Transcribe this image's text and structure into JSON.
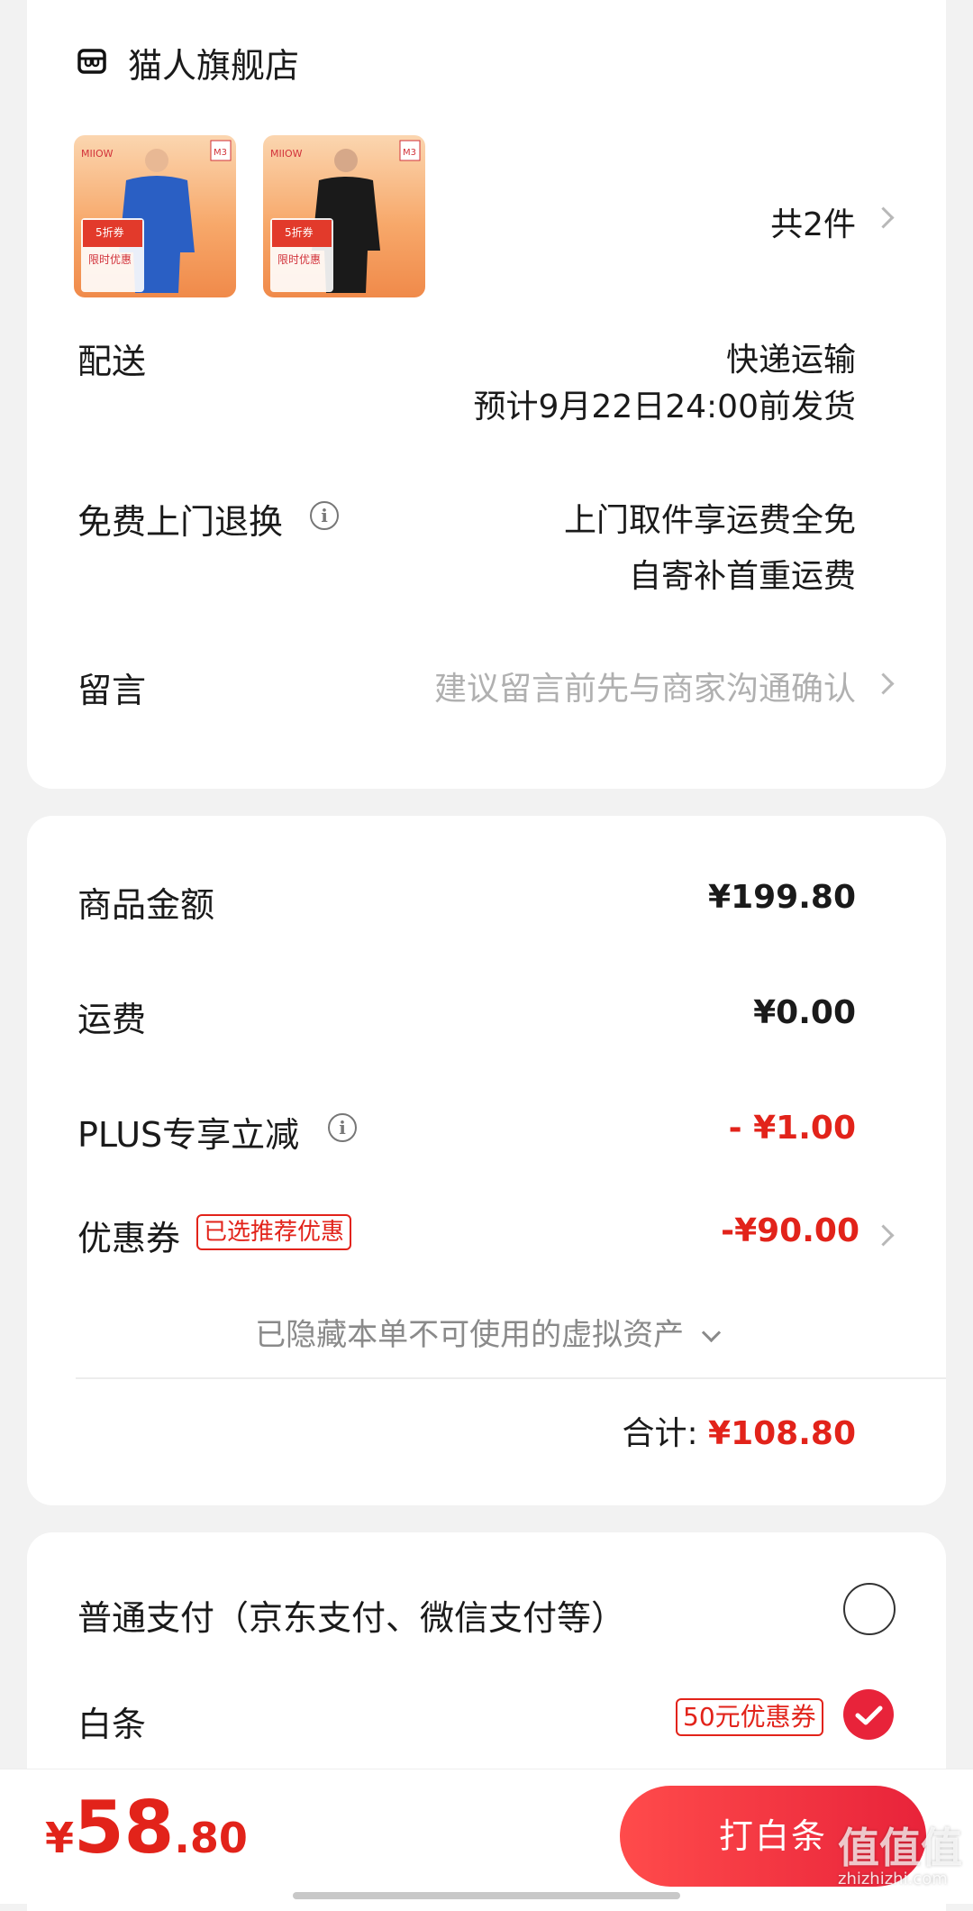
{
  "store": {
    "name": "猫人旗舰店",
    "products": [
      {
        "brand": "MIIOW",
        "badge": "M3",
        "promo": "限时优惠",
        "image": "man-blue-thermal"
      },
      {
        "brand": "MIIOW",
        "badge": "M3",
        "promo": "限时优惠",
        "image": "woman-black-thermal"
      }
    ],
    "count_label": "共2件"
  },
  "delivery": {
    "label": "配送",
    "method": "快递运输",
    "eta": "预计9月22日24:00前发货"
  },
  "returns": {
    "label": "免费上门退换",
    "line1": "上门取件享运费全免",
    "line2": "自寄补首重运费"
  },
  "message": {
    "label": "留言",
    "placeholder": "建议留言前先与商家沟通确认"
  },
  "price": {
    "goods_label": "商品金额",
    "goods_value": "¥199.80",
    "shipping_label": "运费",
    "shipping_value": "¥0.00",
    "plus_label": "PLUS专享立减",
    "plus_value": "- ¥1.00",
    "coupon_label": "优惠券",
    "coupon_tag": "已选推荐优惠",
    "coupon_value": "-¥90.00",
    "hidden_note": "已隐藏本单不可使用的虚拟资产",
    "total_label": "合计:",
    "total_value": "¥108.80"
  },
  "payment": {
    "normal_label": "普通支付（京东支付、微信支付等）",
    "baitiao_label": "白条",
    "baitiao_tag": "50元优惠券",
    "selected": "白条"
  },
  "bottom": {
    "currency": "¥",
    "amount_int": "58",
    "amount_dec": ".80",
    "button_label": "打白条"
  },
  "watermark": {
    "text": "值值值",
    "sub": "zhizhizhi.com"
  },
  "colors": {
    "accent_red": "#e2231a",
    "background": "#f2f2f2"
  }
}
